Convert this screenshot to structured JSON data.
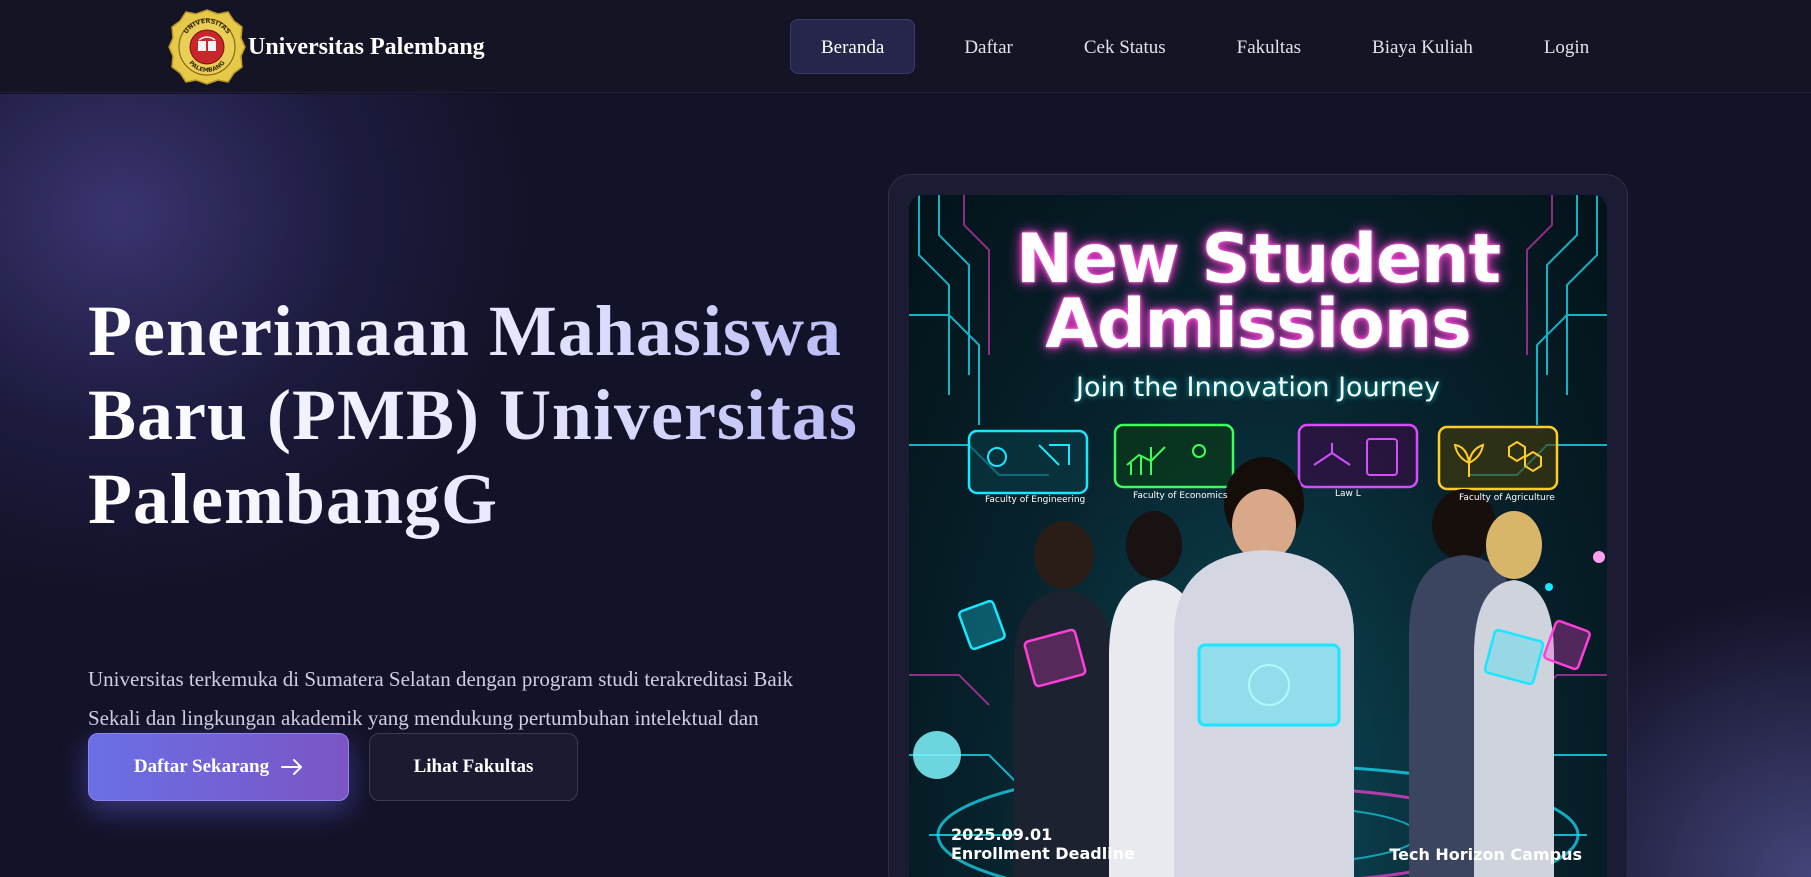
{
  "header": {
    "brand_name": "Universitas Palembang",
    "logo_icon": "university-seal-icon",
    "logo_text_top": "UNIVERSITAS",
    "logo_text_bottom": "PALEMBANG",
    "nav": [
      {
        "label": "Beranda",
        "active": true
      },
      {
        "label": "Daftar",
        "active": false
      },
      {
        "label": "Cek Status",
        "active": false
      },
      {
        "label": "Fakultas",
        "active": false
      },
      {
        "label": "Biaya Kuliah",
        "active": false
      },
      {
        "label": "Login",
        "active": false
      }
    ]
  },
  "hero": {
    "title_line1": "Penerimaan Mahasiswa",
    "title_line2": "Baru (PMB) Universitas",
    "title_line3": "PalembangG",
    "description": "Universitas terkemuka di Sumatera Selatan dengan program studi terakreditasi Baik Sekali dan lingkungan akademik yang mendukung pertumbuhan intelektual dan profesional.",
    "primary_button": "Daftar Sekarang",
    "primary_button_icon": "arrow-right-icon",
    "secondary_button": "Lihat Fakultas"
  },
  "poster": {
    "title_line1": "New Student",
    "title_line2": "Admissions",
    "subtitle": "Join the Innovation Journey",
    "faculties": [
      "Faculty of Engineering",
      "Faculty of Economics",
      "Law L",
      "Faculty of Agriculture"
    ],
    "date": "2025.09.01",
    "deadline_label": "Enrollment Deadline",
    "campus": "Tech Horizon Campus"
  },
  "colors": {
    "background": "#121228",
    "navbar": "#141424",
    "accent_start": "#6a6fe6",
    "accent_end": "#7b55c4",
    "neon_cyan": "#19e6ff",
    "neon_magenta": "#ff3fd8"
  }
}
